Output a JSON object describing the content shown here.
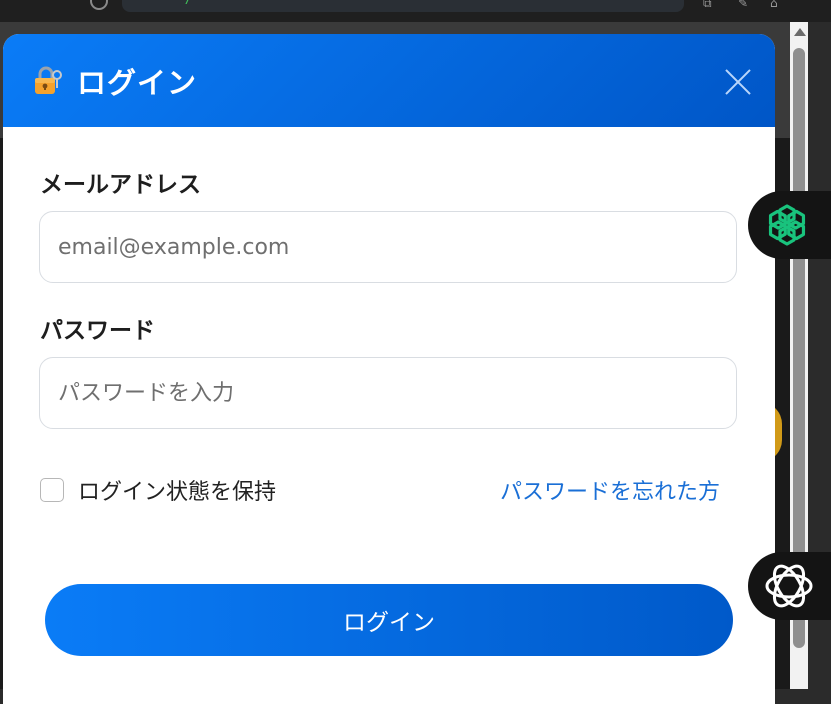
{
  "browser": {
    "address_text": "ー ー ー ー ー"
  },
  "modal": {
    "title": "ログイン",
    "header_icon": "lock-with-key-icon",
    "close_icon": "close-icon",
    "email": {
      "label": "メールアドレス",
      "placeholder": "email@example.com",
      "value": ""
    },
    "password": {
      "label": "パスワード",
      "placeholder": "パスワードを入力",
      "value": ""
    },
    "remember_me": {
      "label": "ログイン状態を保持",
      "checked": false
    },
    "forgot_password_link": "パスワードを忘れた方",
    "submit_label": "ログイン"
  },
  "side_buttons": [
    {
      "icon": "chatgpt-logo-icon",
      "color": "#19c37d"
    },
    {
      "icon": "openai-hexagon-logo-icon",
      "color": "#ffffff"
    }
  ],
  "colors": {
    "accent": "#0a7cf7",
    "accent_dark": "#0056c7",
    "link": "#1a6fd6"
  }
}
